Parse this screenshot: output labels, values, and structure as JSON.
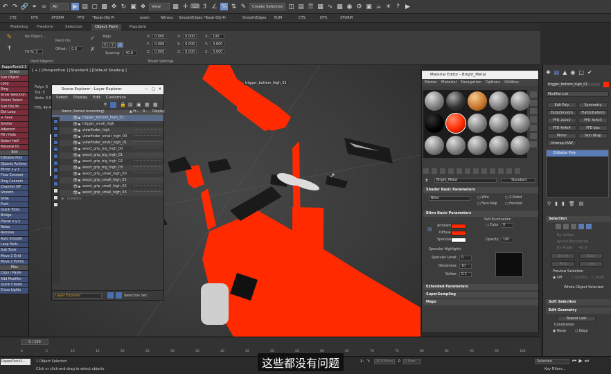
{
  "toolbar": {
    "selection_filter": "All",
    "view_mode": "View",
    "selection_set": "Create Selection Se"
  },
  "shelf": [
    "CTS",
    "DTS",
    "XFORM",
    "PFD",
    "*Baub-Obj Pr",
    "exuin",
    "Nitrous",
    "SmoothEdges",
    "*Baub-Obj Pr",
    "SmoothEdges",
    "EUM",
    "CTS",
    "DTS",
    "XFORM"
  ],
  "ribbon": {
    "tabs": [
      "Modeling",
      "Freeform",
      "Selection",
      "Object Paint",
      "Populate"
    ],
    "active_tab": "Object Paint",
    "no_object": "No Object...",
    "fill_n": "Fill N",
    "fill_val": "3",
    "paint_on": "Paint On:",
    "offset": "Offset:",
    "offset_val": "0.0",
    "align": "Align",
    "spacing": "Spacing:",
    "spacing_val": "40.0",
    "brush_settings": "Brush Settings",
    "paint_objects": "Paint Objects",
    "rot_labels": [
      "X:",
      "Y:",
      "Z:"
    ],
    "rot_vals": [
      "0.000",
      "0.000",
      "0.000"
    ],
    "scale_labels": [
      "U:",
      "X:",
      "Y:",
      "Z:"
    ],
    "scale_vals": [
      "0.000",
      "0.000",
      "0.000",
      "0.000"
    ],
    "pos_labels": [
      "X:",
      "Y:",
      "Z:"
    ],
    "pos_vals": [
      "100",
      "0.000",
      "0.000"
    ],
    "axes": [
      "X",
      "Y",
      "Z"
    ]
  },
  "left_panel": {
    "title": "RappeTools3.5",
    "select": "Select",
    "buttons": [
      "Sub Object",
      "Loop",
      "Ring",
      "Grow Selection",
      "Shrink Select",
      "Sub Obj Ito",
      "Dot Loop",
      "+ Save",
      "Similar",
      "Adjacent",
      "Fill / Hole",
      "Select Half",
      "Material ID",
      "Edit",
      "Editable Poly",
      "Objects Actions",
      "Mirror x y z",
      "Flow Connect",
      "Ring Connect",
      "Chamfer OP",
      "Smooth",
      "Slide",
      "Push",
      "Quick Tools",
      "Bridge",
      "Planar x y z",
      "Relax",
      "Remove",
      "Auto Smooth",
      "Loop Tools",
      "Sub Tools",
      "Move 2 Grid",
      "Move 2 Points",
      "Misc",
      "Copy / Paste",
      "Add Modifier",
      "Quick Create",
      "Cross Lights"
    ]
  },
  "viewport": {
    "label": "[ + ] [Perspective ] [Standard ] [Default Shading ]",
    "stats_labels": [
      "Polys:",
      "Tris:",
      "Verts:",
      "FPS:"
    ],
    "stats_vals": [
      "5",
      "5",
      "2.5",
      "49.40"
    ],
    "selected_name": "trigger_bottom_high_01"
  },
  "scene_explorer": {
    "title": "Scene Explorer - Layer Explorer",
    "menus": [
      "Select",
      "Display",
      "Edit",
      "Customize"
    ],
    "header": "Name (Sorted Ascending)",
    "header_cols": [
      "▲ Fr...",
      "R...",
      "Display"
    ],
    "rows": [
      "trigger_bottom_high_01",
      "trigger_small_high",
      "viewfinder_high",
      "viewfinder_small_high_00",
      "viewfinder_small_high_01",
      "wood_grip_big_high_00",
      "wood_grip_big_high_01",
      "wood_grip_big_high_02",
      "wood_grip_big_high_03",
      "wood_grip_small_high_00",
      "wood_grip_small_high_01",
      "wood_grip_small_high_02",
      "wood_grip_small_high_03",
      "Lowpoly"
    ],
    "footer_dropdown": "Layer Explorer",
    "footer_selset": "Selection Set:"
  },
  "material_editor": {
    "title": "Material Editor - Bright_Metal",
    "menus": [
      "Modes",
      "Material",
      "Navigation",
      "Options",
      "Utilities"
    ],
    "material_name": "Bright_Metal",
    "material_type": "Standard",
    "shader_section": "Shader Basic Parameters",
    "shader_type": "Blinn",
    "shader_opts": [
      "Wire",
      "2-Sided",
      "Face Map",
      "Faceted"
    ],
    "blinn_section": "Blinn Basic Parameters",
    "self_illum": "Self-Illumination",
    "color_label": "Color",
    "color_val": "0",
    "ambient": "Ambient:",
    "diffuse": "Diffuse:",
    "specular": "Specular:",
    "opacity": "Opacity:",
    "opacity_val": "100",
    "spec_highlights": "Specular Highlights",
    "spec_level": "Specular Level:",
    "spec_level_val": "0",
    "glossiness": "Glossiness:",
    "glossiness_val": "10",
    "soften": "Soften:",
    "soften_val": "0.1",
    "ext_params": "Extended Parameters",
    "supersampling": "SuperSampling",
    "maps": "Maps",
    "diffuse_color": "#ff2a00",
    "ambient_color": "#ff2a00",
    "specular_color": "#ffffff"
  },
  "command_panel": {
    "object_name": "trigger_bottom_high_01",
    "modifier_list": "Modifier List",
    "mod_buttons": [
      "Edit Poly",
      "Symmetry",
      "TurboSmooth",
      "FlatUnDeform",
      "FFD 2x2x2",
      "FFD 3x3x3",
      "FFD 4x4x4",
      "FFD box",
      "Mirror",
      "Skin Wrap",
      "Unwrap UVW"
    ],
    "stack_item": "Editable Poly",
    "selection": "Selection",
    "by_vertex": "By Vertex",
    "ignore_backfacing": "Ignore Backfacing",
    "by_angle": "By Angle:",
    "by_angle_val": "45.0",
    "shrink": "Shrink",
    "grow": "Grow",
    "ring": "Ring",
    "loop": "Loop",
    "preview_selection": "Preview Selection",
    "off": "Off",
    "subobj": "SubObj",
    "multi": "Multi",
    "whole_object": "Whole Object Selected",
    "soft_selection": "Soft Selection",
    "edit_geometry": "Edit Geometry",
    "repeat_last": "Repeat Last",
    "constraints": "Constraints",
    "none": "None",
    "edge": "Edge"
  },
  "timeline": {
    "frame": "0 / 100",
    "ticks": [
      "0",
      "5",
      "10",
      "15",
      "20",
      "25",
      "30",
      "35",
      "40",
      "45",
      "50",
      "55",
      "60",
      "65",
      "70",
      "75",
      "80",
      "85",
      "90",
      "95",
      "100"
    ]
  },
  "status": {
    "script_name": "RappeTools3...",
    "selected": "1 Object Selected",
    "hint": "Click or click-and-drag to select objects",
    "x_label": "X:",
    "y_label": "Y:",
    "y_val": "25.036cm",
    "z_label": "Z:",
    "z_val": "0.0cm",
    "selected_dropdown": "Selected",
    "key_filters": "Key Filters..."
  },
  "subtitle": "这些都没有问题"
}
